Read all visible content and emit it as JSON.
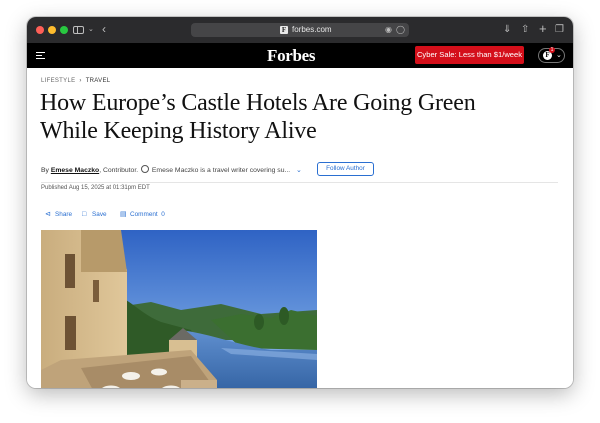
{
  "browser": {
    "url": "forbes.com",
    "favicon_letter": "F"
  },
  "nav": {
    "logo": "Forbes",
    "sale_button": "Cyber Sale: Less than $1/week",
    "user_initial": "F",
    "notification_count": "1"
  },
  "article": {
    "breadcrumb": [
      "LIFESTYLE",
      "TRAVEL"
    ],
    "headline_line1": "How Europe’s Castle Hotels Are Going Green",
    "headline_line2": "While Keeping History Alive",
    "byline_prefix": "By",
    "author": "Emese Maczko",
    "author_role": ", Contributor.",
    "author_desc": "Emese Maczko is a travel writer covering su...",
    "follow_button": "Follow Author",
    "published": "Published Aug 15, 2025 at 01:31pm EDT",
    "actions": {
      "share": "Share",
      "save": "Save",
      "comment": "Comment",
      "comment_count": "0"
    }
  },
  "colors": {
    "toolbar": "#2b2b2d",
    "nav_bg": "#000000",
    "sale_red": "#d40f1a",
    "link_blue": "#2a6fd1"
  }
}
